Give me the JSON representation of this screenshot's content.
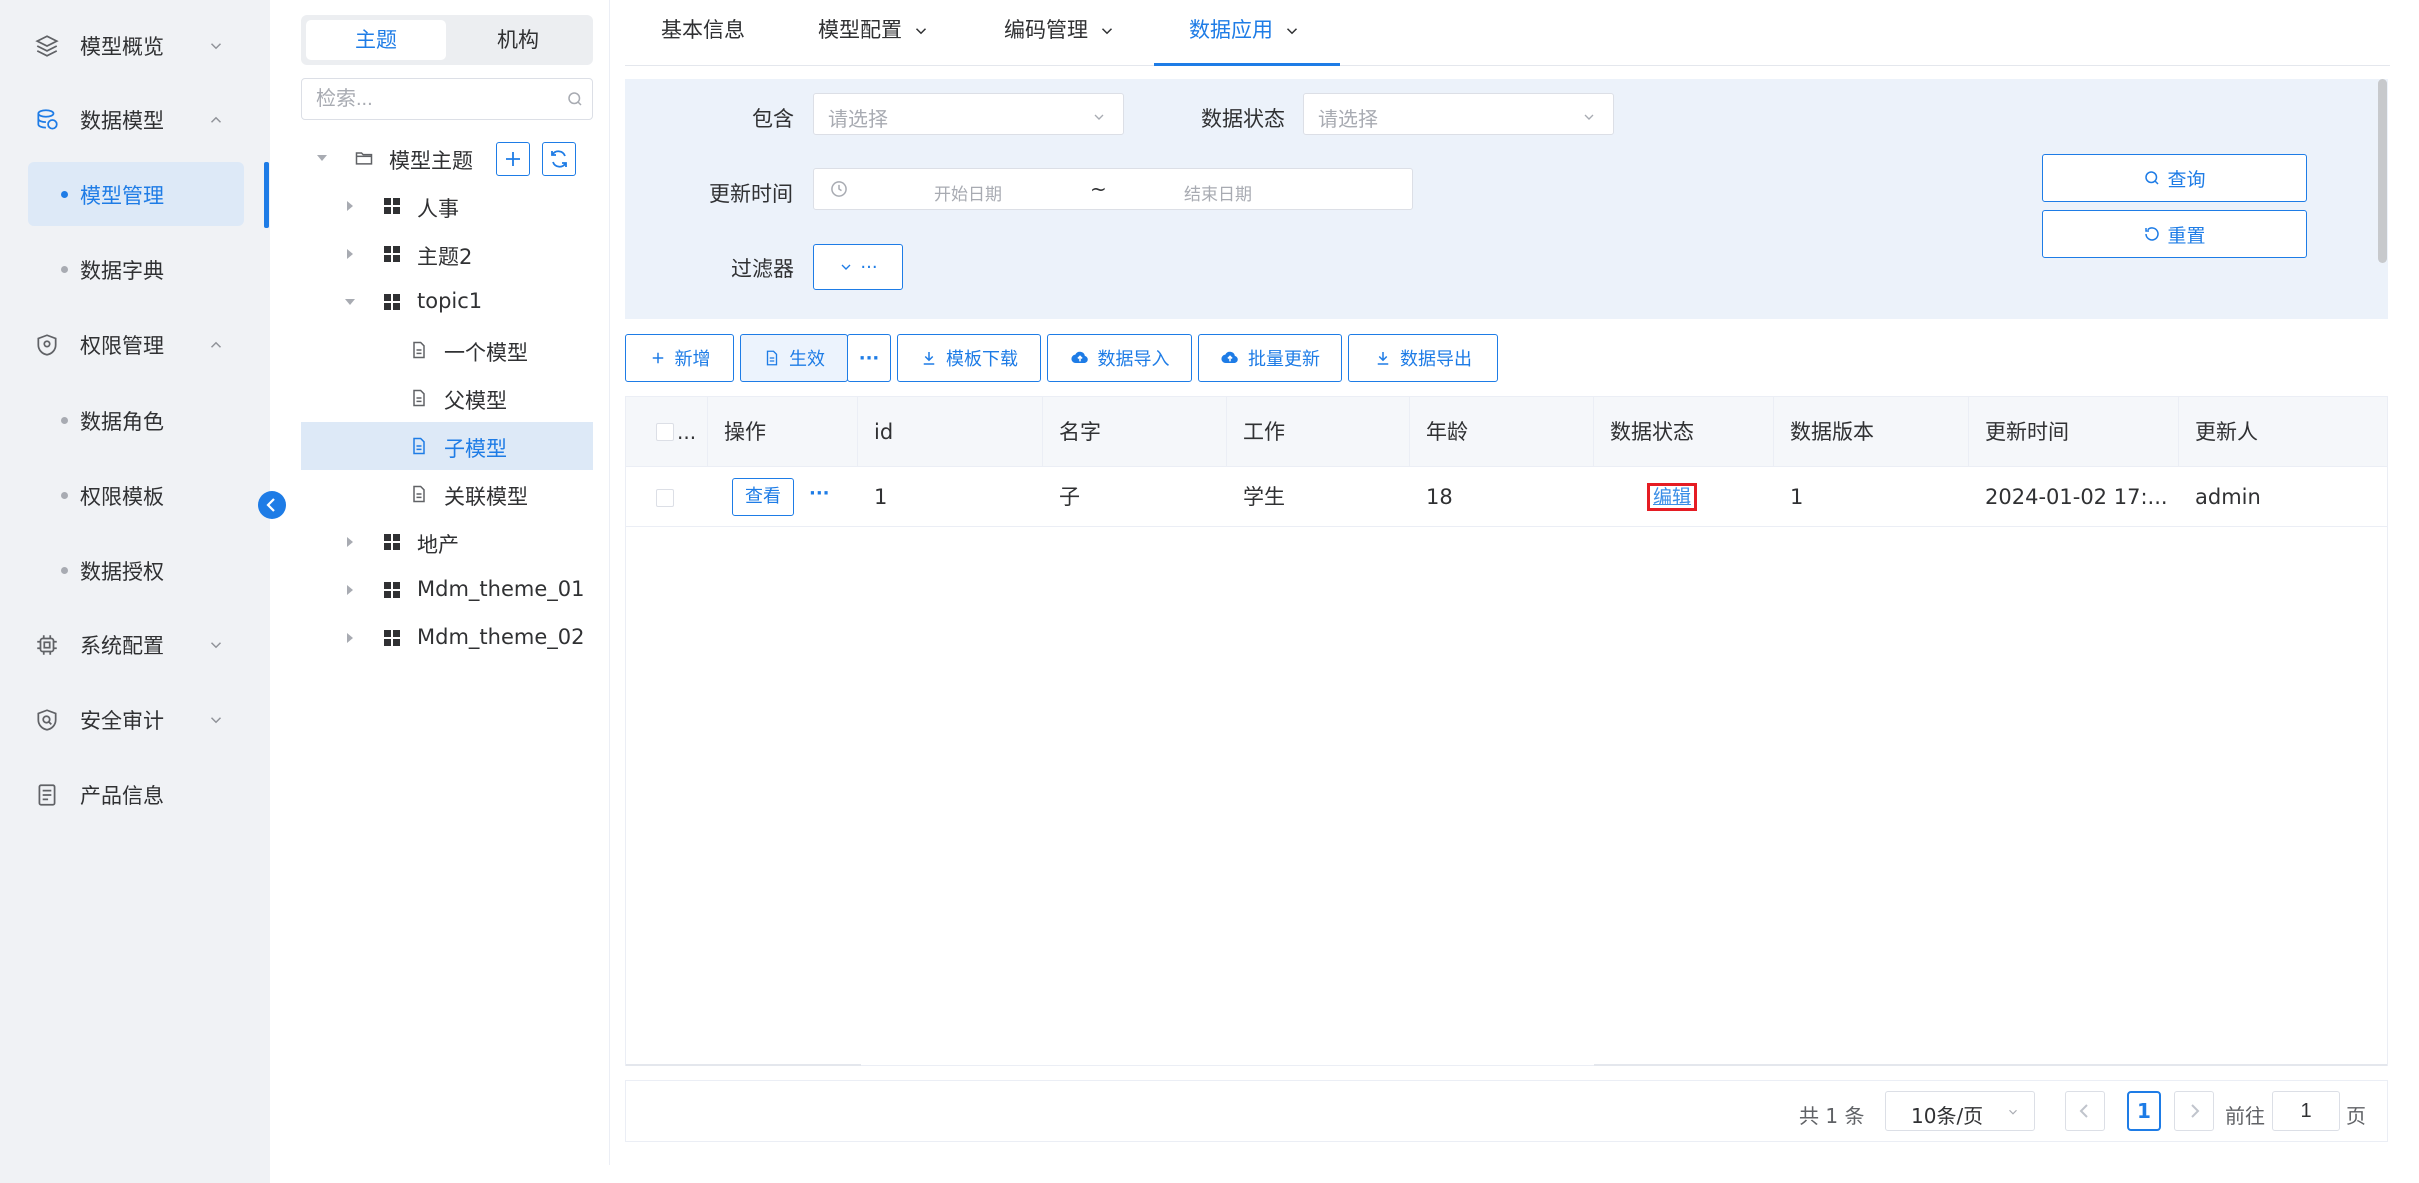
{
  "sidebar": {
    "menu": [
      {
        "label": "模型概览",
        "icon": "layers-icon",
        "expanded": false
      },
      {
        "label": "数据模型",
        "icon": "database-icon",
        "expanded": true,
        "children": [
          "模型管理",
          "数据字典"
        ]
      },
      {
        "label": "权限管理",
        "icon": "shield-icon",
        "expanded": true,
        "children": [
          "数据角色",
          "权限模板",
          "数据授权"
        ]
      },
      {
        "label": "系统配置",
        "icon": "chip-icon",
        "expanded": false
      },
      {
        "label": "安全审计",
        "icon": "shield-check-icon",
        "expanded": false
      },
      {
        "label": "产品信息",
        "icon": "document-icon",
        "expanded": false
      }
    ],
    "active_item": "模型管理"
  },
  "tree_panel": {
    "tabs": [
      "主题",
      "机构"
    ],
    "active_tab": "主题",
    "search_placeholder": "检索...",
    "root": "模型主题",
    "nodes": [
      {
        "label": "人事",
        "type": "theme",
        "level": 1
      },
      {
        "label": "主题2",
        "type": "theme",
        "level": 1
      },
      {
        "label": "topic1",
        "type": "theme",
        "level": 1,
        "expanded": true
      },
      {
        "label": "一个模型",
        "type": "model",
        "level": 2
      },
      {
        "label": "父模型",
        "type": "model",
        "level": 2
      },
      {
        "label": "子模型",
        "type": "model",
        "level": 2,
        "selected": true
      },
      {
        "label": "关联模型",
        "type": "model",
        "level": 2
      },
      {
        "label": "地产",
        "type": "theme",
        "level": 1
      },
      {
        "label": "Mdm_theme_01",
        "type": "theme",
        "level": 1
      },
      {
        "label": "Mdm_theme_02",
        "type": "theme",
        "level": 1
      }
    ]
  },
  "top_tabs": [
    {
      "label": "基本信息",
      "has_dropdown": false
    },
    {
      "label": "模型配置",
      "has_dropdown": true
    },
    {
      "label": "编码管理",
      "has_dropdown": true
    },
    {
      "label": "数据应用",
      "has_dropdown": true,
      "active": true
    }
  ],
  "filter": {
    "include_label": "包含",
    "include_placeholder": "请选择",
    "status_label": "数据状态",
    "status_placeholder": "请选择",
    "update_time_label": "更新时间",
    "start_placeholder": "开始日期",
    "range_separator": "~",
    "end_placeholder": "结束日期",
    "filter_label": "过滤器",
    "filter_button": "···",
    "query_button": "查询",
    "reset_button": "重置"
  },
  "toolbar": {
    "add": "新增",
    "activate": "生效",
    "more": "···",
    "template_download": "模板下载",
    "data_import": "数据导入",
    "batch_update": "批量更新",
    "data_export": "数据导出"
  },
  "table": {
    "select_all_label": "...",
    "columns": [
      "操作",
      "id",
      "名字",
      "工作",
      "年龄",
      "数据状态",
      "数据版本",
      "更新时间",
      "更新人"
    ],
    "rows": [
      {
        "action": "查看",
        "action_more": "···",
        "id": "1",
        "name": "子",
        "job": "学生",
        "age": "18",
        "status": "编辑",
        "version": "1",
        "updated_at": "2024-01-02 17:...",
        "updated_by": "admin"
      }
    ]
  },
  "pagination": {
    "total_text": "共 1 条",
    "page_size": "10条/页",
    "current_page": "1",
    "goto_label": "前往",
    "goto_value": "1",
    "page_suffix": "页"
  },
  "colors": {
    "primary": "#1e7ce6",
    "highlight_border": "#e51c23",
    "filter_bg": "#ecf2fa",
    "sidebar_bg": "#f0f2f5"
  }
}
